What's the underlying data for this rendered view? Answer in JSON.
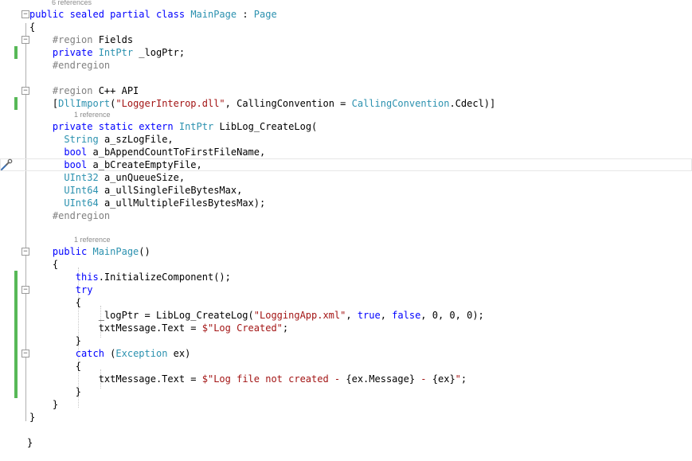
{
  "editor": {
    "lenses": {
      "class_refs": "6 references",
      "extern_refs": "1 reference",
      "ctor_refs": "1 reference"
    },
    "lines": [
      {
        "tokens": [
          {
            "c": "k",
            "t": "public "
          },
          {
            "c": "k",
            "t": "sealed "
          },
          {
            "c": "k",
            "t": "partial "
          },
          {
            "c": "k",
            "t": "class "
          },
          {
            "c": "t",
            "t": "MainPage"
          },
          {
            "c": "",
            "t": " : "
          },
          {
            "c": "t",
            "t": "Page"
          }
        ]
      },
      {
        "tokens": [
          {
            "c": "",
            "t": "{"
          }
        ]
      },
      {
        "tokens": [
          {
            "c": "",
            "t": "    "
          },
          {
            "c": "p",
            "t": "#region "
          },
          {
            "c": "",
            "t": "Fields"
          }
        ]
      },
      {
        "tokens": [
          {
            "c": "",
            "t": "    "
          },
          {
            "c": "k",
            "t": "private "
          },
          {
            "c": "t",
            "t": "IntPtr"
          },
          {
            "c": "",
            "t": " _logPtr;"
          }
        ]
      },
      {
        "tokens": [
          {
            "c": "",
            "t": "    "
          },
          {
            "c": "p",
            "t": "#endregion"
          }
        ]
      },
      {
        "tokens": []
      },
      {
        "tokens": [
          {
            "c": "",
            "t": "    "
          },
          {
            "c": "p",
            "t": "#region "
          },
          {
            "c": "",
            "t": "C++ API"
          }
        ]
      },
      {
        "tokens": [
          {
            "c": "",
            "t": "    ["
          },
          {
            "c": "t",
            "t": "DllImport"
          },
          {
            "c": "",
            "t": "("
          },
          {
            "c": "s",
            "t": "\"LoggerInterop.dll\""
          },
          {
            "c": "",
            "t": ", CallingConvention = "
          },
          {
            "c": "t",
            "t": "CallingConvention"
          },
          {
            "c": "",
            "t": ".Cdecl)]"
          }
        ]
      },
      {
        "tokens": [
          {
            "c": "",
            "t": "    "
          },
          {
            "c": "k",
            "t": "private "
          },
          {
            "c": "k",
            "t": "static "
          },
          {
            "c": "k",
            "t": "extern "
          },
          {
            "c": "t",
            "t": "IntPtr"
          },
          {
            "c": "",
            "t": " LibLog_CreateLog("
          }
        ]
      },
      {
        "tokens": [
          {
            "c": "",
            "t": "      "
          },
          {
            "c": "t",
            "t": "String"
          },
          {
            "c": "",
            "t": " a_szLogFile,"
          }
        ]
      },
      {
        "tokens": [
          {
            "c": "",
            "t": "      "
          },
          {
            "c": "k",
            "t": "bool"
          },
          {
            "c": "",
            "t": " a_bAppendCountToFirstFileName,"
          }
        ]
      },
      {
        "tokens": [
          {
            "c": "",
            "t": "      "
          },
          {
            "c": "k",
            "t": "bool"
          },
          {
            "c": "",
            "t": " a_bCreateEmptyFile,"
          }
        ]
      },
      {
        "tokens": [
          {
            "c": "",
            "t": "      "
          },
          {
            "c": "t",
            "t": "UInt32"
          },
          {
            "c": "",
            "t": " a_unQueueSize,"
          }
        ]
      },
      {
        "tokens": [
          {
            "c": "",
            "t": "      "
          },
          {
            "c": "t",
            "t": "UInt64"
          },
          {
            "c": "",
            "t": " a_ullSingleFileBytesMax,"
          }
        ]
      },
      {
        "tokens": [
          {
            "c": "",
            "t": "      "
          },
          {
            "c": "t",
            "t": "UInt64"
          },
          {
            "c": "",
            "t": " a_ullMultipleFilesBytesMax);"
          }
        ]
      },
      {
        "tokens": [
          {
            "c": "",
            "t": "    "
          },
          {
            "c": "p",
            "t": "#endregion"
          }
        ]
      },
      {
        "tokens": []
      },
      {
        "tokens": [
          {
            "c": "",
            "t": "    "
          },
          {
            "c": "k",
            "t": "public "
          },
          {
            "c": "t",
            "t": "MainPage"
          },
          {
            "c": "",
            "t": "()"
          }
        ]
      },
      {
        "tokens": [
          {
            "c": "",
            "t": "    {"
          }
        ]
      },
      {
        "tokens": [
          {
            "c": "",
            "t": "        "
          },
          {
            "c": "k",
            "t": "this"
          },
          {
            "c": "",
            "t": ".InitializeComponent();"
          }
        ]
      },
      {
        "tokens": [
          {
            "c": "",
            "t": "        "
          },
          {
            "c": "k",
            "t": "try"
          }
        ]
      },
      {
        "tokens": [
          {
            "c": "",
            "t": "        {"
          }
        ]
      },
      {
        "tokens": [
          {
            "c": "",
            "t": "            _logPtr = LibLog_CreateLog("
          },
          {
            "c": "s",
            "t": "\"LoggingApp.xml\""
          },
          {
            "c": "",
            "t": ", "
          },
          {
            "c": "k",
            "t": "true"
          },
          {
            "c": "",
            "t": ", "
          },
          {
            "c": "k",
            "t": "false"
          },
          {
            "c": "",
            "t": ", 0, 0, 0);"
          }
        ]
      },
      {
        "tokens": [
          {
            "c": "",
            "t": "            txtMessage.Text = "
          },
          {
            "c": "s",
            "t": "$\"Log Created\""
          },
          {
            "c": "",
            "t": ";"
          }
        ]
      },
      {
        "tokens": [
          {
            "c": "",
            "t": "        }"
          }
        ]
      },
      {
        "tokens": [
          {
            "c": "",
            "t": "        "
          },
          {
            "c": "k",
            "t": "catch "
          },
          {
            "c": "",
            "t": "("
          },
          {
            "c": "t",
            "t": "Exception"
          },
          {
            "c": "",
            "t": " ex)"
          }
        ]
      },
      {
        "tokens": [
          {
            "c": "",
            "t": "        {"
          }
        ]
      },
      {
        "tokens": [
          {
            "c": "",
            "t": "            txtMessage.Text = "
          },
          {
            "c": "s",
            "t": "$\"Log file not created - "
          },
          {
            "c": "",
            "t": "{ex.Message}"
          },
          {
            "c": "s",
            "t": " - "
          },
          {
            "c": "",
            "t": "{ex}"
          },
          {
            "c": "s",
            "t": "\""
          },
          {
            "c": "",
            "t": ";"
          }
        ]
      },
      {
        "tokens": [
          {
            "c": "",
            "t": "        }"
          }
        ]
      },
      {
        "tokens": [
          {
            "c": "",
            "t": "    }"
          }
        ]
      },
      {
        "tokens": [
          {
            "c": "",
            "t": "}"
          }
        ]
      }
    ],
    "folds": {
      "class": "−",
      "region_fields": "−",
      "region_api": "−",
      "ctor": "−",
      "try": "−",
      "catch": "−"
    },
    "closing_brace": "}",
    "tray_icon": "wrench-icon",
    "colors": {
      "keyword": "#0000ff",
      "type": "#2b91af",
      "string": "#a31515",
      "preprocessor": "#808080",
      "change_marker": "#57b857"
    }
  }
}
